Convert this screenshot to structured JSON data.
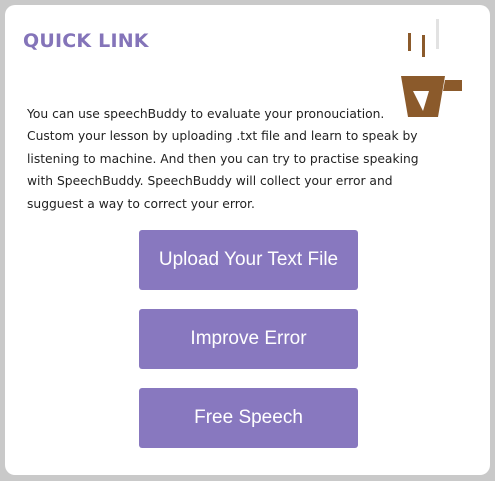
{
  "panel": {
    "title": "QUICK LINK",
    "description": "You can use speechBuddy to evaluate your pronouciation. Custom your lesson by uploading .txt file and learn to speak by listening to machine. And then you can try to practise speaking with SpeechBuddy. SpeechBuddy will collect your error and sugguest a way to correct your error.",
    "decorative_icon": "coffee-cup-icon"
  },
  "buttons": {
    "upload_label": "Upload Your Text File",
    "improve_label": "Improve Error",
    "free_label": "Free Speech"
  },
  "colors": {
    "accent": "#8878bf",
    "title": "#8474b9",
    "cup": "#8b5a2b",
    "background": "#c9c9c9"
  }
}
